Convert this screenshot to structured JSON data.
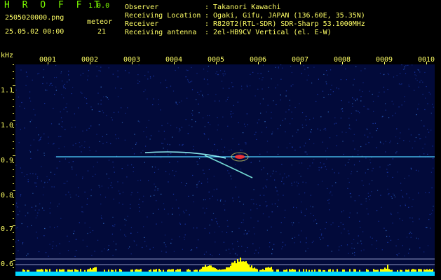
{
  "header": {
    "app_name": "H R O F F T",
    "version": "1.0.0",
    "filename": "2505020000.png",
    "datetime": "25.05.02 00:00",
    "meteor_label": "meteor",
    "meteor_count": "21",
    "observer_label": "Observer",
    "observer_value": ": Takanori Kawachi",
    "location_label": "Receiving Location",
    "location_value": ": Ogaki, Gifu, JAPAN (136.60E, 35.35N)",
    "receiver_label": "Receiver",
    "receiver_value": ": R820T2(RTL-SDR) SDR-Sharp 53.1000MHz",
    "antenna_label": "Receiving antenna",
    "antenna_value": ": 2el-HB9CV Vertical (el. E-W)"
  },
  "axis": {
    "unit": "kHz",
    "x_ticks": [
      "0001",
      "0002",
      "0003",
      "0004",
      "0005",
      "0006",
      "0007",
      "0008",
      "0009",
      "0010"
    ],
    "y_ticks": [
      "1.1",
      "1.0",
      "0.9",
      "0.8",
      "0.7",
      "0.6"
    ]
  },
  "colors": {
    "background": "#000000",
    "spectrogram_bg": "#020a3a",
    "label_yellow": "#FFFF66",
    "label_green": "#7CFC00",
    "carrier_line": "#4fd0ff",
    "histogram": "#FFFF00",
    "histogram_base": "#00d8ff"
  }
}
